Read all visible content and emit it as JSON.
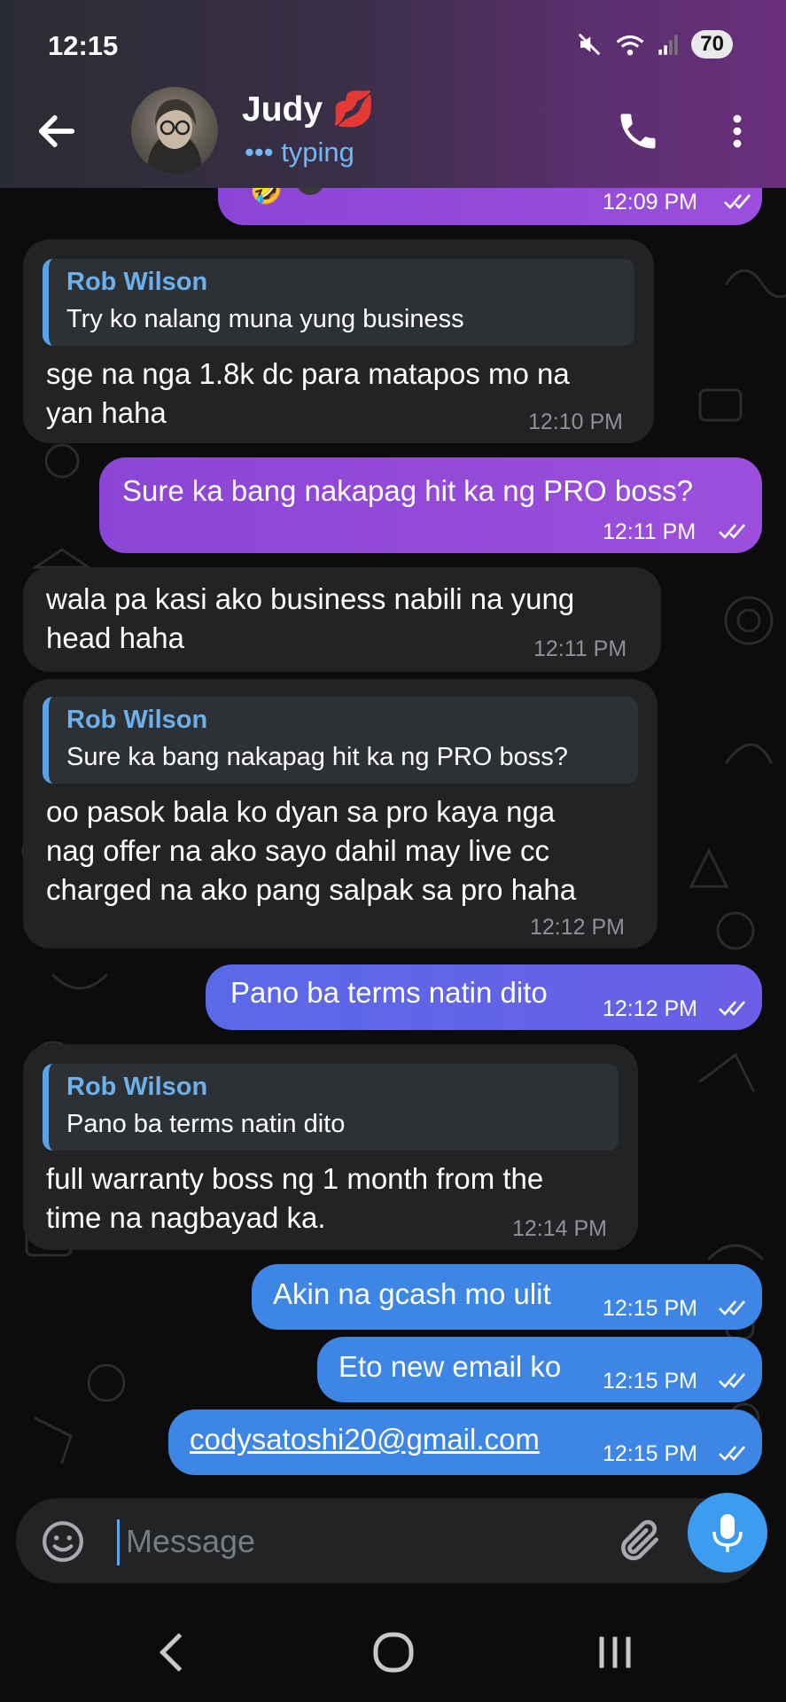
{
  "status_bar": {
    "time": "12:15",
    "battery": "70"
  },
  "header": {
    "contact_name": "Judy 💋",
    "status": "typing",
    "status_dots": "•••"
  },
  "messages": [
    {
      "time": "12:09 PM"
    },
    {
      "quote_name": "Rob Wilson",
      "quote_text": "Try ko nalang muna yung business",
      "text_line1": "sge na nga 1.8k dc para matapos mo na",
      "text_line2": "yan haha",
      "time": "12:10 PM"
    },
    {
      "text": "Sure ka bang nakapag hit ka ng PRO boss?",
      "time": "12:11 PM"
    },
    {
      "text_line1": "wala pa kasi ako business nabili na yung",
      "text_line2": "head haha",
      "time": "12:11 PM"
    },
    {
      "quote_name": "Rob Wilson",
      "quote_text": "Sure ka bang nakapag hit ka ng PRO boss?",
      "text_line1": "oo pasok bala ko dyan sa pro kaya nga",
      "text_line2": "nag offer na ako sayo dahil may live cc",
      "text_line3": "charged na ako pang salpak sa pro haha",
      "time": "12:12 PM"
    },
    {
      "text": "Pano ba terms natin dito",
      "time": "12:12 PM"
    },
    {
      "quote_name": "Rob Wilson",
      "quote_text": "Pano ba terms natin dito",
      "text_line1": "full warranty boss ng 1 month from the",
      "text_line2": "time na nagbayad ka.",
      "time": "12:14 PM"
    },
    {
      "text": "Akin na gcash mo ulit",
      "time": "12:15 PM"
    },
    {
      "text": "Eto new email ko",
      "time": "12:15 PM"
    },
    {
      "text": "codysatoshi20@gmail.com",
      "time": "12:15 PM"
    }
  ],
  "composer": {
    "placeholder": "Message"
  },
  "icons": {
    "back": "arrow-left-icon",
    "call": "phone-icon",
    "menu": "more-vertical-icon",
    "emoji": "smiley-icon",
    "attach": "paperclip-icon",
    "mic": "microphone-icon",
    "nav_back": "chevron-left-icon",
    "nav_home": "circle-icon",
    "nav_recents": "bars-icon"
  },
  "colors": {
    "accent_blue": "#3b9cf0",
    "quote_name": "#6cb0ec",
    "outgoing_purple": "#8b45d6",
    "outgoing_blue": "#3d86e6",
    "incoming": "#222325"
  }
}
